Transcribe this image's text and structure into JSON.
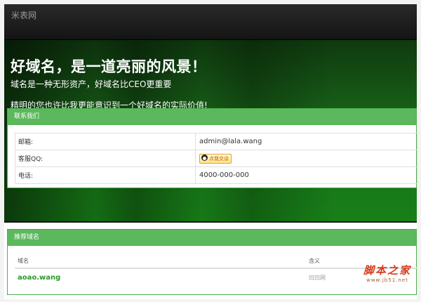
{
  "navbar": {
    "brand": "米表网"
  },
  "hero": {
    "title": "好域名，是一道亮丽的风景！",
    "subtitle": "域名是一种无形资产，好域名比CEO更重要",
    "subtitle2": "精明的您也许比我更能意识到一个好域名的实际价值!"
  },
  "contact": {
    "heading": "联系我们",
    "rows": [
      {
        "label": "邮箱:",
        "value": "admin@lala.wang"
      },
      {
        "label": "客服QQ:",
        "value": "点我交谈"
      },
      {
        "label": "电话:",
        "value": "4000-000-000"
      }
    ],
    "qq_icon": "qq-penguin-icon"
  },
  "domains": {
    "heading": "推荐域名",
    "columns": [
      "域名",
      "含义"
    ],
    "rows": [
      {
        "name": "aoao.wang",
        "meaning": "凹凹网"
      }
    ]
  },
  "watermark": {
    "text": "脚本之家",
    "url": "www.jb51.net"
  },
  "colors": {
    "accent": "#5cb85c",
    "hero": "#1b6e1b",
    "navbar": "#1e1e1e",
    "domain_link": "#2a9a2a"
  }
}
